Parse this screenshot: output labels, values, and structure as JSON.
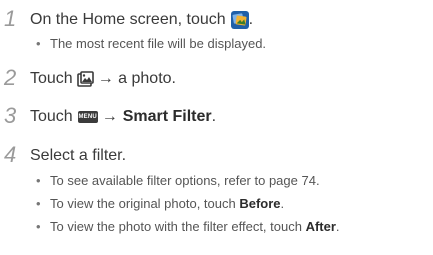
{
  "steps": [
    {
      "number": "1",
      "before_icon": "On the Home screen, touch",
      "after_icon": ".",
      "icon": "gallery-icon",
      "bullets": [
        {
          "text": "The most recent file will be displayed."
        }
      ]
    },
    {
      "number": "2",
      "before_icon": "Touch",
      "icon": "photo-icon",
      "after_icon": "→ a photo.",
      "bullets": []
    },
    {
      "number": "3",
      "before_icon": "Touch",
      "icon": "menu-icon",
      "menu_key_label": "MENU",
      "arrow": "→",
      "bold_text": "Smart Filter",
      "after_bold": ".",
      "bullets": []
    },
    {
      "number": "4",
      "text": "Select a filter.",
      "bullets": [
        {
          "text": "To see available filter options, refer to page 74."
        },
        {
          "text": "To view the original photo, touch ",
          "bold": "Before",
          "after": "."
        },
        {
          "text": "To view the photo with the filter effect, touch ",
          "bold": "After",
          "after": "."
        }
      ]
    }
  ],
  "bullet_glyph": "•",
  "colors": {
    "text": "#3a3a3a",
    "step_number": "#9a9a9a",
    "bullet_text": "#555555",
    "icon_gallery_bg": "#1f5fa8",
    "icon_gallery_accent": "#f2b233"
  }
}
